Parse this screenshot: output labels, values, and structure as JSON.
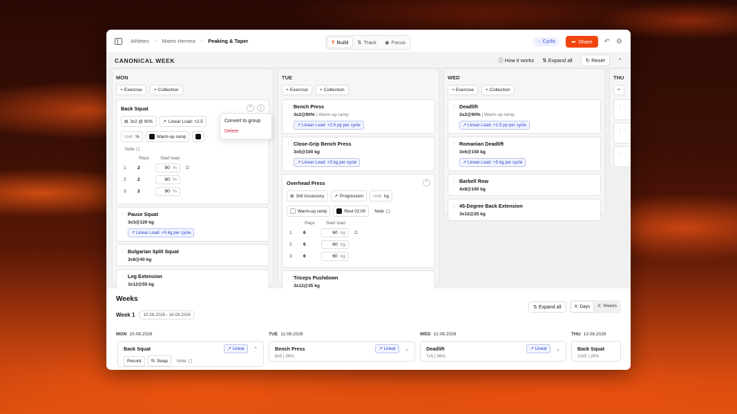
{
  "breadcrumb": {
    "items": [
      "Athletes",
      "Mateo Herrera",
      "Peaking & Taper"
    ]
  },
  "modes": [
    {
      "label": "Build",
      "icon": "t-logo-icon"
    },
    {
      "label": "Track",
      "icon": "arrows-icon"
    },
    {
      "label": "Focus",
      "icon": "target-icon"
    }
  ],
  "topbar": {
    "cyclic": "Cyclic",
    "share": "Share"
  },
  "section": {
    "title": "CANONICAL WEEK",
    "how": "How it works",
    "expand": "Expand all",
    "reset": "Reset"
  },
  "add": {
    "exercise": "Exercise",
    "collection": "Collection"
  },
  "days": {
    "mon": {
      "name": "MON",
      "back_squat": {
        "title": "Back Squat",
        "chip1": "3x2 @ 90%",
        "chip2": "Linear Load: +2.5",
        "unit_label": "Unit:",
        "unit": "%",
        "warmup": "Warm-up ramp",
        "note": "Note",
        "reps_h": "Reps",
        "load_h": "Start load",
        "sets": [
          {
            "n": "1",
            "r": "2",
            "v": "90",
            "u": "%"
          },
          {
            "n": "2",
            "r": "2",
            "v": "90",
            "u": "%"
          },
          {
            "n": "3",
            "r": "2",
            "v": "90",
            "u": "%"
          }
        ]
      },
      "menu": {
        "convert": "Convert to group",
        "delete": "Delete"
      },
      "cards": [
        {
          "title": "Pause Squat",
          "sub": "3x3@120 kg",
          "lin": "Linear Load: +5 kg per cycle"
        },
        {
          "title": "Bulgarian Split Squat",
          "sub": "3x8@40 kg"
        },
        {
          "title": "Leg Extension",
          "sub": "3x12@55 kg"
        }
      ]
    },
    "tue": {
      "name": "TUE",
      "cards": [
        {
          "title": "Bench Press",
          "sub": "3x2@90%",
          "meta": "Warm-up ramp",
          "lin": "Linear Load: +2.5 pp per cycle"
        },
        {
          "title": "Close-Grip Bench Press",
          "sub": "3x5@100 kg",
          "lin": "Linear Load: +5 kg per cycle"
        }
      ],
      "ohp": {
        "title": "Overhead Press",
        "chip1": "3x8 Accessory",
        "chip2": "Progression",
        "unit_label": "Unit:",
        "unit": "kg",
        "warmup": "Warm-up ramp",
        "rest": "Rest 02:00",
        "note": "Note",
        "reps_h": "Reps",
        "load_h": "Start load",
        "sets": [
          {
            "n": "1",
            "r": "6",
            "v": "60",
            "u": "kg"
          },
          {
            "n": "2",
            "r": "6",
            "v": "60",
            "u": "kg"
          },
          {
            "n": "3",
            "r": "6",
            "v": "60",
            "u": "kg"
          }
        ]
      },
      "last": {
        "title": "Triceps Pushdown",
        "sub": "3x12@35 kg"
      }
    },
    "wed": {
      "name": "WED",
      "cards": [
        {
          "title": "Deadlift",
          "sub": "2x2@90%",
          "meta": "Warm-up ramp",
          "lin": "Linear Load: +2.5 pp per cycle"
        },
        {
          "title": "Romanian Deadlift",
          "sub": "3x6@150 kg",
          "lin": "Linear Load: +5 kg per cycle"
        },
        {
          "title": "Barbell Row",
          "sub": "4x8@100 kg"
        },
        {
          "title": "45-Degree Back Extension",
          "sub": "3x12@25 kg"
        }
      ]
    },
    "thu": {
      "name": "THU"
    }
  },
  "weeks": {
    "title": "Weeks",
    "expand": "Expand all",
    "xdays": "X: Days",
    "xweeks": "X: Weeks",
    "week": "Week 1",
    "range": "10.08.2026 - 16.08.2026",
    "cols": [
      {
        "day": "MON",
        "date": "10.08.2026",
        "title": "Back Squat",
        "lin": "Linear",
        "record": "Record",
        "swap": "Swap",
        "note": "Note"
      },
      {
        "day": "TUE",
        "date": "11.08.2026",
        "title": "Bench Press",
        "stat": "8x5 | 36%",
        "lin": "Linear"
      },
      {
        "day": "WED",
        "date": "12.08.2026",
        "title": "Deadlift",
        "stat": "7x5 | 36%",
        "lin": "Linear"
      },
      {
        "day": "THU",
        "date": "13.08.2026",
        "title": "Back Squat",
        "stat": "10x5 | 28%"
      }
    ]
  }
}
